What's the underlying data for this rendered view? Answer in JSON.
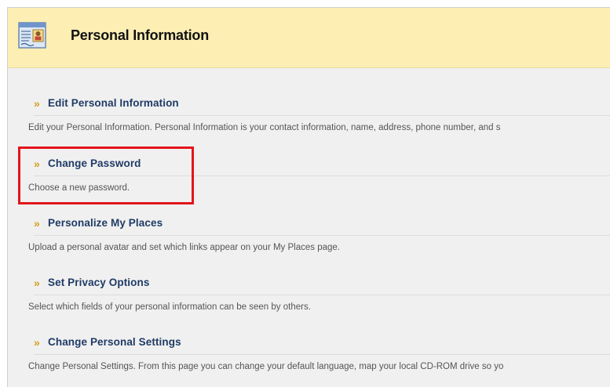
{
  "header": {
    "title": "Personal Information",
    "icon": "personal-info-card-icon"
  },
  "sections": [
    {
      "label": "Edit Personal Information",
      "description": "Edit your Personal Information. Personal Information is your contact information, name, address, phone number, and s"
    },
    {
      "label": "Change Password",
      "description": "Choose a new password."
    },
    {
      "label": "Personalize My Places",
      "description": "Upload a personal avatar and set which links appear on your My Places page."
    },
    {
      "label": "Set Privacy Options",
      "description": "Select which fields of your personal information can be seen by others."
    },
    {
      "label": "Change Personal Settings",
      "description": "Change Personal Settings. From this page you can change your default language, map your local CD-ROM drive so yo"
    }
  ],
  "chevron_glyph": "»",
  "colors": {
    "header_bg": "#fdeeb4",
    "link": "#1f3b66",
    "chevron": "#d4a017",
    "highlight": "#e3141b"
  }
}
